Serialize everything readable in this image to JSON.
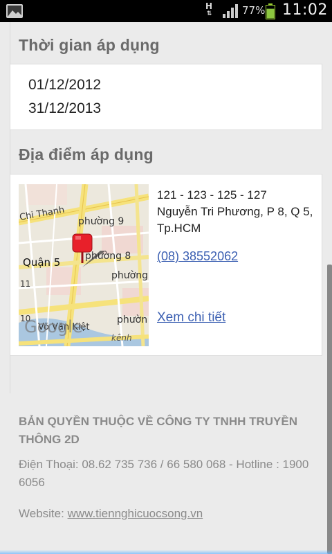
{
  "status_bar": {
    "network_type": "H",
    "battery_percent": "77%",
    "battery_level": 0.77,
    "time": "11:02",
    "icons": [
      "gallery-icon",
      "data-arrows-icon",
      "signal-icon",
      "battery-icon"
    ]
  },
  "time_section": {
    "title": "Thời gian áp dụng",
    "start_date": "01/12/2012",
    "end_date": "31/12/2013"
  },
  "location_section": {
    "title": "Địa điểm áp dụng",
    "address_line1": "121 - 123 - 125 - 127",
    "address_line2": "Nguyễn Tri Phương, P 8, Q 5,",
    "address_line3": "Tp.HCM",
    "phone": "(08) 38552062",
    "detail_link": "Xem chi tiết",
    "map": {
      "labels": {
        "street_chi_thanh": "Chi Thanh",
        "ward_9": "phường 9",
        "ward_8": "phường 8",
        "district_5": "Quận 5",
        "ward_a": "phường",
        "ward_b": "phườn",
        "num_11": "11",
        "num_10": "10",
        "street_vo_van_kiet": "Võ Văn Kiệt",
        "canal": "kênh",
        "brand": "Google"
      },
      "marker_color": "#e8202a"
    }
  },
  "footer": {
    "copyright": "BẢN QUYỀN THUỘC VỀ CÔNG TY TNHH TRUYỀN THÔNG 2D",
    "contact": "Điện Thoại: 08.62 735 736 / 66 580 068  - Hotline : 1900 6056",
    "website_label": "Website: ",
    "website_url": "www.tiennghicuocsong.vn"
  },
  "colors": {
    "link": "#3b5fb2",
    "section_title": "#6a6a6a",
    "footer_text": "#8a8a8a",
    "background": "#ebebeb"
  }
}
